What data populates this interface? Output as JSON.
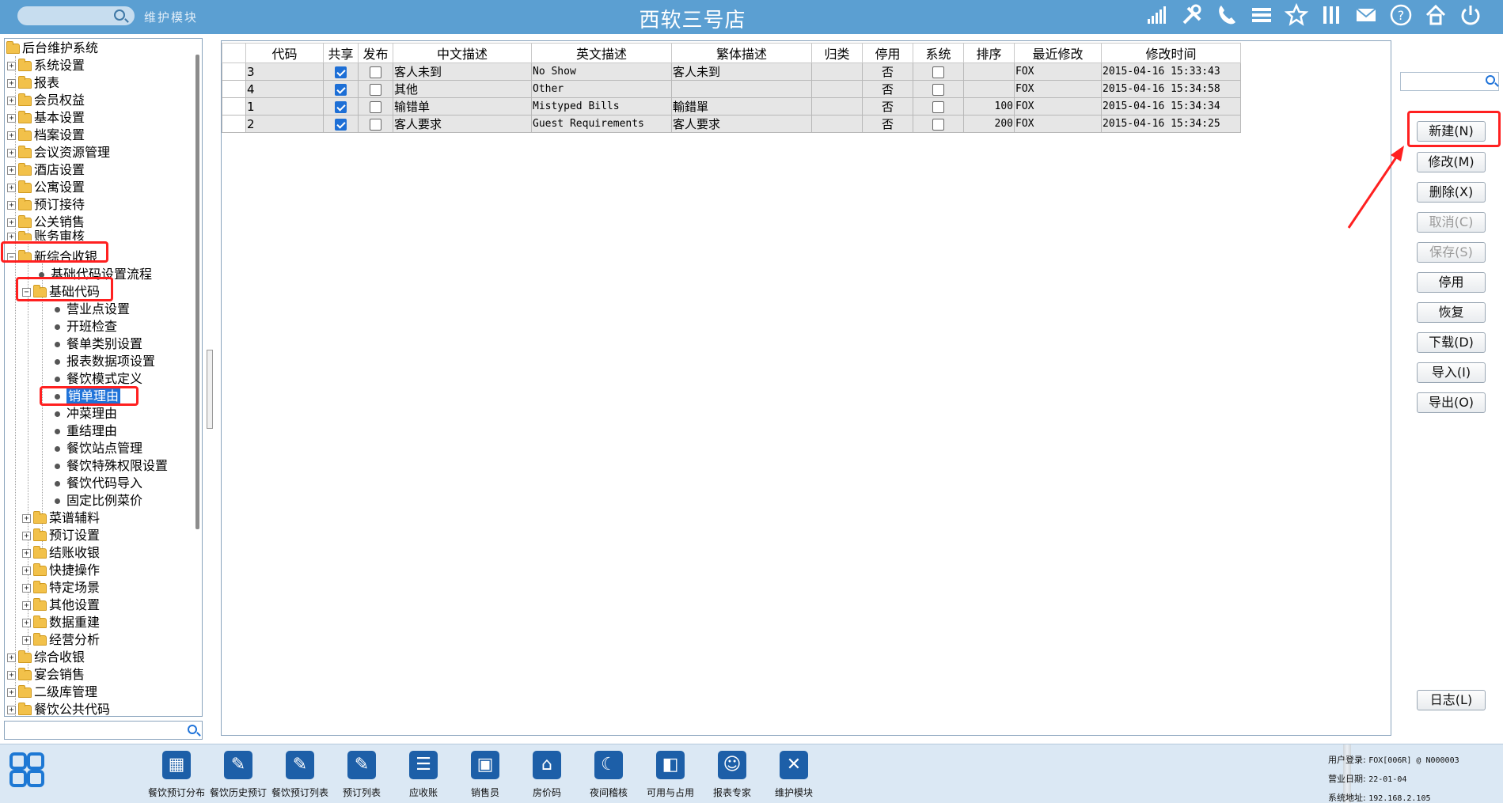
{
  "header": {
    "module_label": "维护模块",
    "store_title": "西软三号店",
    "tool_icons": [
      "signal-icon",
      "tools-icon",
      "phone-icon",
      "menu-icon",
      "star-icon",
      "columns-icon",
      "mail-icon",
      "help-icon",
      "home-icon",
      "power-icon"
    ]
  },
  "tree": {
    "root": "后台维护系统",
    "top_items": [
      "系统设置",
      "报表",
      "会员权益",
      "基本设置",
      "档案设置",
      "会议资源管理",
      "酒店设置",
      "公寓设置",
      "预订接待",
      "公关销售",
      "账务审核"
    ],
    "expanded": "新综合收银",
    "leaf_flow": "基础代码设置流程",
    "sub_expanded": "基础代码",
    "leaves": [
      "营业点设置",
      "开班检查",
      "餐单类别设置",
      "报表数据项设置",
      "餐饮模式定义",
      "销单理由",
      "冲菜理由",
      "重结理由",
      "餐饮站点管理",
      "餐饮特殊权限设置",
      "餐饮代码导入",
      "固定比例菜价"
    ],
    "selected": "销单理由",
    "sub_folders": [
      "菜谱辅料",
      "预订设置",
      "结账收银",
      "快捷操作",
      "特定场景",
      "其他设置",
      "数据重建",
      "经营分析"
    ],
    "bottom_items": [
      "综合收银",
      "宴会销售",
      "二级库管理",
      "餐饮公共代码"
    ]
  },
  "grid": {
    "columns": [
      "代码",
      "共享",
      "发布",
      "中文描述",
      "英文描述",
      "繁体描述",
      "归类",
      "停用",
      "系统",
      "排序",
      "最近修改",
      "修改时间"
    ],
    "rows": [
      {
        "code": "3",
        "shared": true,
        "published": false,
        "zh": "客人未到",
        "en": "No Show",
        "tw": "客人未到",
        "category": "",
        "disabled": "否",
        "system": false,
        "order": "",
        "modifier": "FOX",
        "time": "2015-04-16 15:33:43"
      },
      {
        "code": "4",
        "shared": true,
        "published": false,
        "zh": "其他",
        "en": "Other",
        "tw": "",
        "category": "",
        "disabled": "否",
        "system": false,
        "order": "",
        "modifier": "FOX",
        "time": "2015-04-16 15:34:58"
      },
      {
        "code": "1",
        "shared": true,
        "published": false,
        "zh": "输错单",
        "en": "Mistyped Bills",
        "tw": "輸錯單",
        "category": "",
        "disabled": "否",
        "system": false,
        "order": "100",
        "modifier": "FOX",
        "time": "2015-04-16 15:34:34"
      },
      {
        "code": "2",
        "shared": true,
        "published": false,
        "zh": "客人要求",
        "en": "Guest Requirements",
        "tw": "客人要求",
        "category": "",
        "disabled": "否",
        "system": false,
        "order": "200",
        "modifier": "FOX",
        "time": "2015-04-16 15:34:25"
      }
    ]
  },
  "buttons": {
    "new": "新建(N)",
    "modify": "修改(M)",
    "delete": "删除(X)",
    "cancel": "取消(C)",
    "save": "保存(S)",
    "disable": "停用",
    "restore": "恢复",
    "download": "下载(D)",
    "import": "导入(I)",
    "export": "导出(O)",
    "log": "日志(L)"
  },
  "taskbar": {
    "items": [
      "餐饮预订分布",
      "餐饮历史预订",
      "餐饮预订列表",
      "预订列表",
      "应收账",
      "销售员",
      "房价码",
      "夜间稽核",
      "可用与占用",
      "报表专家",
      "维护模块"
    ],
    "status": {
      "user_label": "用户登录:",
      "user": "FOX[006R] @ N000003",
      "date_label": "营业日期:",
      "date": "22-01-04",
      "addr_label": "系统地址:",
      "addr": "192.168.2.105"
    }
  },
  "colors": {
    "header_bg": "#5b9fd2",
    "highlight_red": "#ff2020",
    "selection_blue": "#1f73d9",
    "checkbox_blue": "#1d6fd6"
  }
}
